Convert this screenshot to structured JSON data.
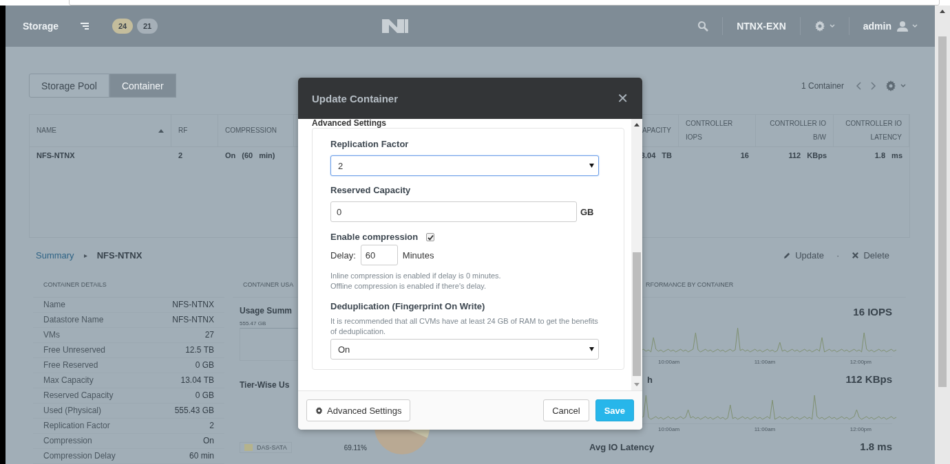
{
  "header": {
    "app_name": "Storage",
    "alerts": [
      {
        "count": "24",
        "color": "#c4bd9c"
      },
      {
        "count": "21",
        "color": "#a6b0b8"
      }
    ],
    "cluster_name": "NTNX-EXN",
    "user": "admin"
  },
  "tabs": [
    {
      "label": "Storage Pool",
      "selected": false
    },
    {
      "label": "Container",
      "selected": true
    }
  ],
  "container_count": "1 Container",
  "table": {
    "columns": [
      {
        "label": "NAME",
        "sorted": true
      },
      {
        "label": "RF",
        "sorted": false
      },
      {
        "label": "COMPRESSION",
        "sorted": false
      },
      {
        "label": "APACITY",
        "sorted": false
      },
      {
        "label": "CONTROLLER IOPS",
        "sorted": false
      },
      {
        "label": "CONTROLLER IO B/W",
        "sorted": false
      },
      {
        "label": "CONTROLLER IO LATENCY",
        "sorted": false
      }
    ],
    "rows": [
      {
        "cells": [
          "NFS-NTNX",
          "2",
          "On (60 min)",
          "3.04 TB",
          "16",
          "112 KBps",
          "1.8 ms"
        ]
      }
    ]
  },
  "summary": {
    "breadcrumb": "Summary",
    "separator": "▸",
    "current": "NFS-NTNX",
    "action_separator": "·",
    "actions": [
      {
        "label": "Update",
        "kind": "edit"
      },
      {
        "label": "Delete",
        "kind": "delete"
      }
    ]
  },
  "details": {
    "title": "CONTAINER DETAILS",
    "rows": [
      {
        "label": "Name",
        "value": "NFS-NTNX"
      },
      {
        "label": "Datastore Name",
        "value": "NFS-NTNX"
      },
      {
        "label": "VMs",
        "value": "27"
      },
      {
        "label": "Free Unreserved",
        "value": "12.5 TB"
      },
      {
        "label": "Free Reserved",
        "value": "0 GB"
      },
      {
        "label": "Max Capacity",
        "value": "13.04 TB"
      },
      {
        "label": "Reserved Capacity",
        "value": "0 GB"
      },
      {
        "label": "Used (Physical)",
        "value": "555.43 GB"
      },
      {
        "label": "Replication Factor",
        "value": "2"
      },
      {
        "label": "Compression",
        "value": "On"
      },
      {
        "label": "Compression Delay",
        "value": "60 min"
      }
    ]
  },
  "usage": {
    "title": "CONTAINER USA",
    "summary_title": "Usage Summ",
    "summary_value": "555.47 GB",
    "tier_title": "Tier-Wise Us",
    "legend": [
      {
        "label": "DAS-SATA",
        "value": "69.11%",
        "color": "#b5b38c"
      }
    ]
  },
  "performance": {
    "title": "RFORMANCE BY CONTAINER",
    "charts": [
      {
        "value": "16 IOPS",
        "times": [
          "10:00am",
          "11:00am",
          "12:00pm"
        ]
      },
      {
        "title": "h",
        "value": "112 KBps",
        "times": [
          "10:00am",
          "11:00am",
          "12:00pm"
        ]
      },
      {
        "title": "Avg IO Latency",
        "value": "1.8 ms"
      }
    ]
  },
  "modal": {
    "title": "Update Container",
    "close": "✕",
    "section_title": "Advanced Settings",
    "replication": {
      "label": "Replication Factor",
      "value": "2",
      "focused": true
    },
    "reserved": {
      "label": "Reserved Capacity",
      "value": "0",
      "unit": "GB"
    },
    "compression": {
      "label": "Enable compression",
      "checked": true,
      "delay_label": "Delay:",
      "delay_value": "60",
      "delay_unit": "Minutes",
      "help": [
        "Inline compression is enabled if delay is 0 minutes.",
        "Offline compression is enabled if there's delay."
      ]
    },
    "dedup": {
      "label": "Deduplication (Fingerprint On Write)",
      "help": "It is recommended that all CVMs have at least 24 GB of RAM to get the benefits of deduplication.",
      "value": "On"
    },
    "buttons": [
      {
        "label": "Advanced Settings",
        "kind": "settings"
      },
      {
        "label": "Cancel",
        "kind": "default"
      },
      {
        "label": "Save",
        "kind": "primary"
      }
    ]
  }
}
